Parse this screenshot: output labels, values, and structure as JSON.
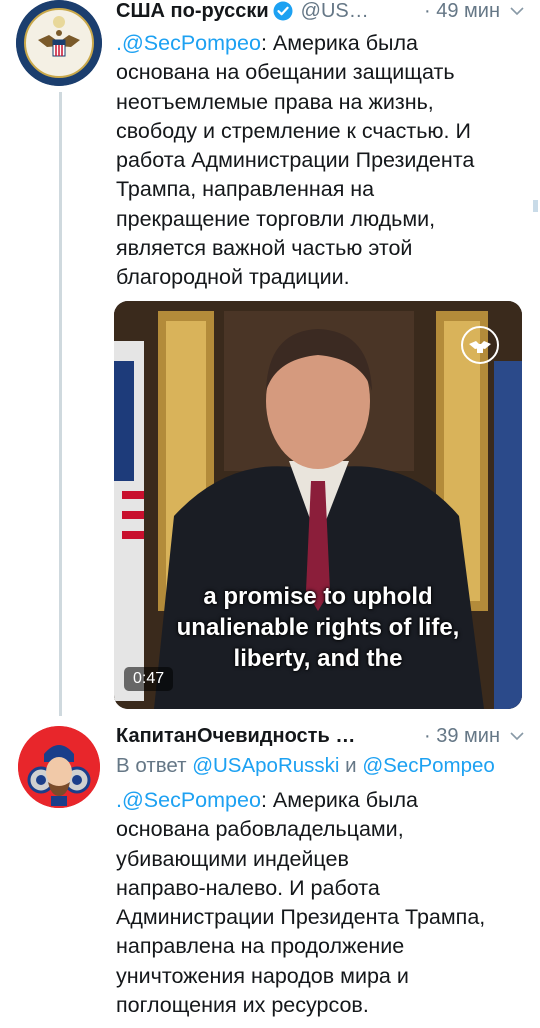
{
  "tweet1": {
    "name": "США по-русски",
    "handle": "@US…",
    "time": "· 49 мин",
    "text_mention": ".@SecPompeo",
    "text_body": ": Америка была\nоснована на обещании защищать\nнеотъемлемые права на жизнь,\nсвободу и стремление к счастью. И\nработа Администрации Президента\nТрампа, направленная на\nпрекращение торговли людьми,\nявляется важной частью этой\nблагородной традиции.",
    "video": {
      "caption_1": "a promise to uphold",
      "caption_2": "unalienable rights of life,",
      "caption_3": "liberty, and the",
      "duration": "0:47"
    }
  },
  "tweet2": {
    "name": "КапитанОчевидность …",
    "time": "· 39 мин",
    "reply_prefix": "В ответ ",
    "reply_user1": "@USApoRusski",
    "reply_and": " и ",
    "reply_user2": "@SecPompeo",
    "text_mention": ".@SecPompeo",
    "text_body": ": Америка была\nоснована рабовладельцами,\nубивающими индейцев\nнаправо-налево. И работа\nАдминистрации Президента Трампа,\nнаправлена на продолжение\nуничтожения народов мира и\nпоглощения их ресурсов."
  },
  "colors": {
    "link": "#1da1f2",
    "muted": "#657786",
    "verified": "#1da1f2",
    "text": "#14171a"
  }
}
